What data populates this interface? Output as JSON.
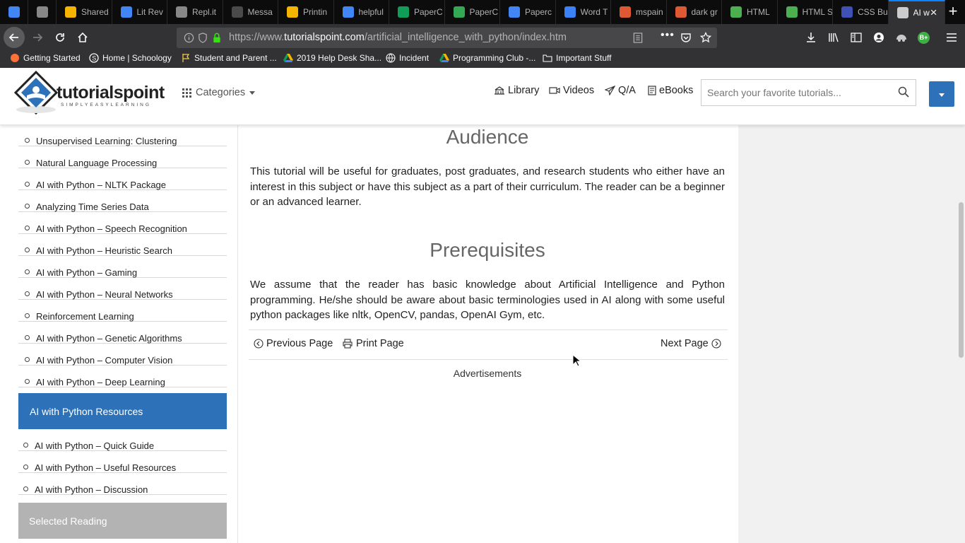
{
  "browser": {
    "tabs": [
      {
        "title": "",
        "icon": "google-docs-icon",
        "color": "#4285f4"
      },
      {
        "title": "",
        "icon": "replit-icon",
        "color": "#888888"
      },
      {
        "title": "Shared",
        "icon": "google-drive-icon",
        "color": "#f4b400"
      },
      {
        "title": "Lit Rev",
        "icon": "google-docs-icon",
        "color": "#4285f4"
      },
      {
        "title": "Repl.it",
        "icon": "replit-icon",
        "color": "#888888"
      },
      {
        "title": "Messa",
        "icon": "schoology-icon",
        "color": "#4a4a4a"
      },
      {
        "title": "Printin",
        "icon": "google-drive-icon",
        "color": "#f4b400"
      },
      {
        "title": "helpful",
        "icon": "google-docs-icon",
        "color": "#4285f4"
      },
      {
        "title": "PaperC",
        "icon": "google-sheets-icon",
        "color": "#0f9d58"
      },
      {
        "title": "PaperC",
        "icon": "paperc-icon",
        "color": "#34a853"
      },
      {
        "title": "Paperc",
        "icon": "google-docs-icon",
        "color": "#4285f4"
      },
      {
        "title": "Word T",
        "icon": "gear-icon",
        "color": "#3b82f6"
      },
      {
        "title": "mspain",
        "icon": "duckduckgo-icon",
        "color": "#de5833"
      },
      {
        "title": "dark gr",
        "icon": "duckduckgo-icon",
        "color": "#de5833"
      },
      {
        "title": "HTML",
        "icon": "w3-icon",
        "color": "#4caf50"
      },
      {
        "title": "HTML S",
        "icon": "w3-icon",
        "color": "#4caf50"
      },
      {
        "title": "CSS Bu",
        "icon": "x-icon",
        "color": "#3f51b5"
      },
      {
        "title": "AI w",
        "icon": "tutorialspoint-icon",
        "color": "#cccccc"
      }
    ],
    "url_prefix": "https://www.",
    "url_host": "tutorialspoint.com",
    "url_path": "/artificial_intelligence_with_python/index.htm",
    "bookmarks": [
      {
        "label": "Getting Started",
        "icon": "firefox-icon"
      },
      {
        "label": "Home | Schoology",
        "icon": "schoology-icon"
      },
      {
        "label": "Student and Parent ...",
        "icon": "flag-icon"
      },
      {
        "label": "2019 Help Desk Sha...",
        "icon": "google-drive-icon"
      },
      {
        "label": "Incident",
        "icon": "globe-icon"
      },
      {
        "label": "Programming Club -...",
        "icon": "google-drive-icon"
      },
      {
        "label": "Important Stuff",
        "icon": "folder-icon"
      }
    ]
  },
  "site": {
    "logo_text": "tutorialspoint",
    "logo_tagline": "SIMPLYEASYLEARNING",
    "categories_label": "Categories",
    "nav": [
      {
        "label": "Library",
        "icon": "library-icon"
      },
      {
        "label": "Videos",
        "icon": "video-icon"
      },
      {
        "label": "Q/A",
        "icon": "paper-plane-icon"
      },
      {
        "label": "eBooks",
        "icon": "ebook-icon"
      }
    ],
    "search_placeholder": "Search your favorite tutorials..."
  },
  "sidebar": {
    "items": [
      "Unsupervised Learning: Clustering",
      "Natural Language Processing",
      "AI with Python – NLTK Package",
      "Analyzing Time Series Data",
      "AI with Python – Speech Recognition",
      "AI with Python – Heuristic Search",
      "AI with Python – Gaming",
      "AI with Python – Neural Networks",
      "Reinforcement Learning",
      "AI with Python – Genetic Algorithms",
      "AI with Python – Computer Vision",
      "AI with Python – Deep Learning"
    ],
    "resources_heading": "AI with Python Resources",
    "resources": [
      "AI with Python – Quick Guide",
      "AI with Python – Useful Resources",
      "AI with Python – Discussion"
    ],
    "selected_reading_heading": "Selected Reading"
  },
  "content": {
    "audience_heading": "Audience",
    "audience_text": "This tutorial will be useful for graduates, post graduates, and research students who either have an interest in this subject or have this subject as a part of their curriculum. The reader can be a beginner or an advanced learner.",
    "prereq_heading": "Prerequisites",
    "prereq_text": "We assume that the reader has basic knowledge about Artificial Intelligence and Python programming. He/she should be aware about basic terminologies used in AI along with some useful python packages like nltk, OpenCV, pandas, OpenAI Gym, etc.",
    "prev_label": "Previous Page",
    "print_label": "Print Page",
    "next_label": "Next Page",
    "ads_label": "Advertisements"
  },
  "colors": {
    "accent_blue": "#2d72b8",
    "selected_reading_bg": "#b3b3b3",
    "browser_dark": "#323234"
  }
}
